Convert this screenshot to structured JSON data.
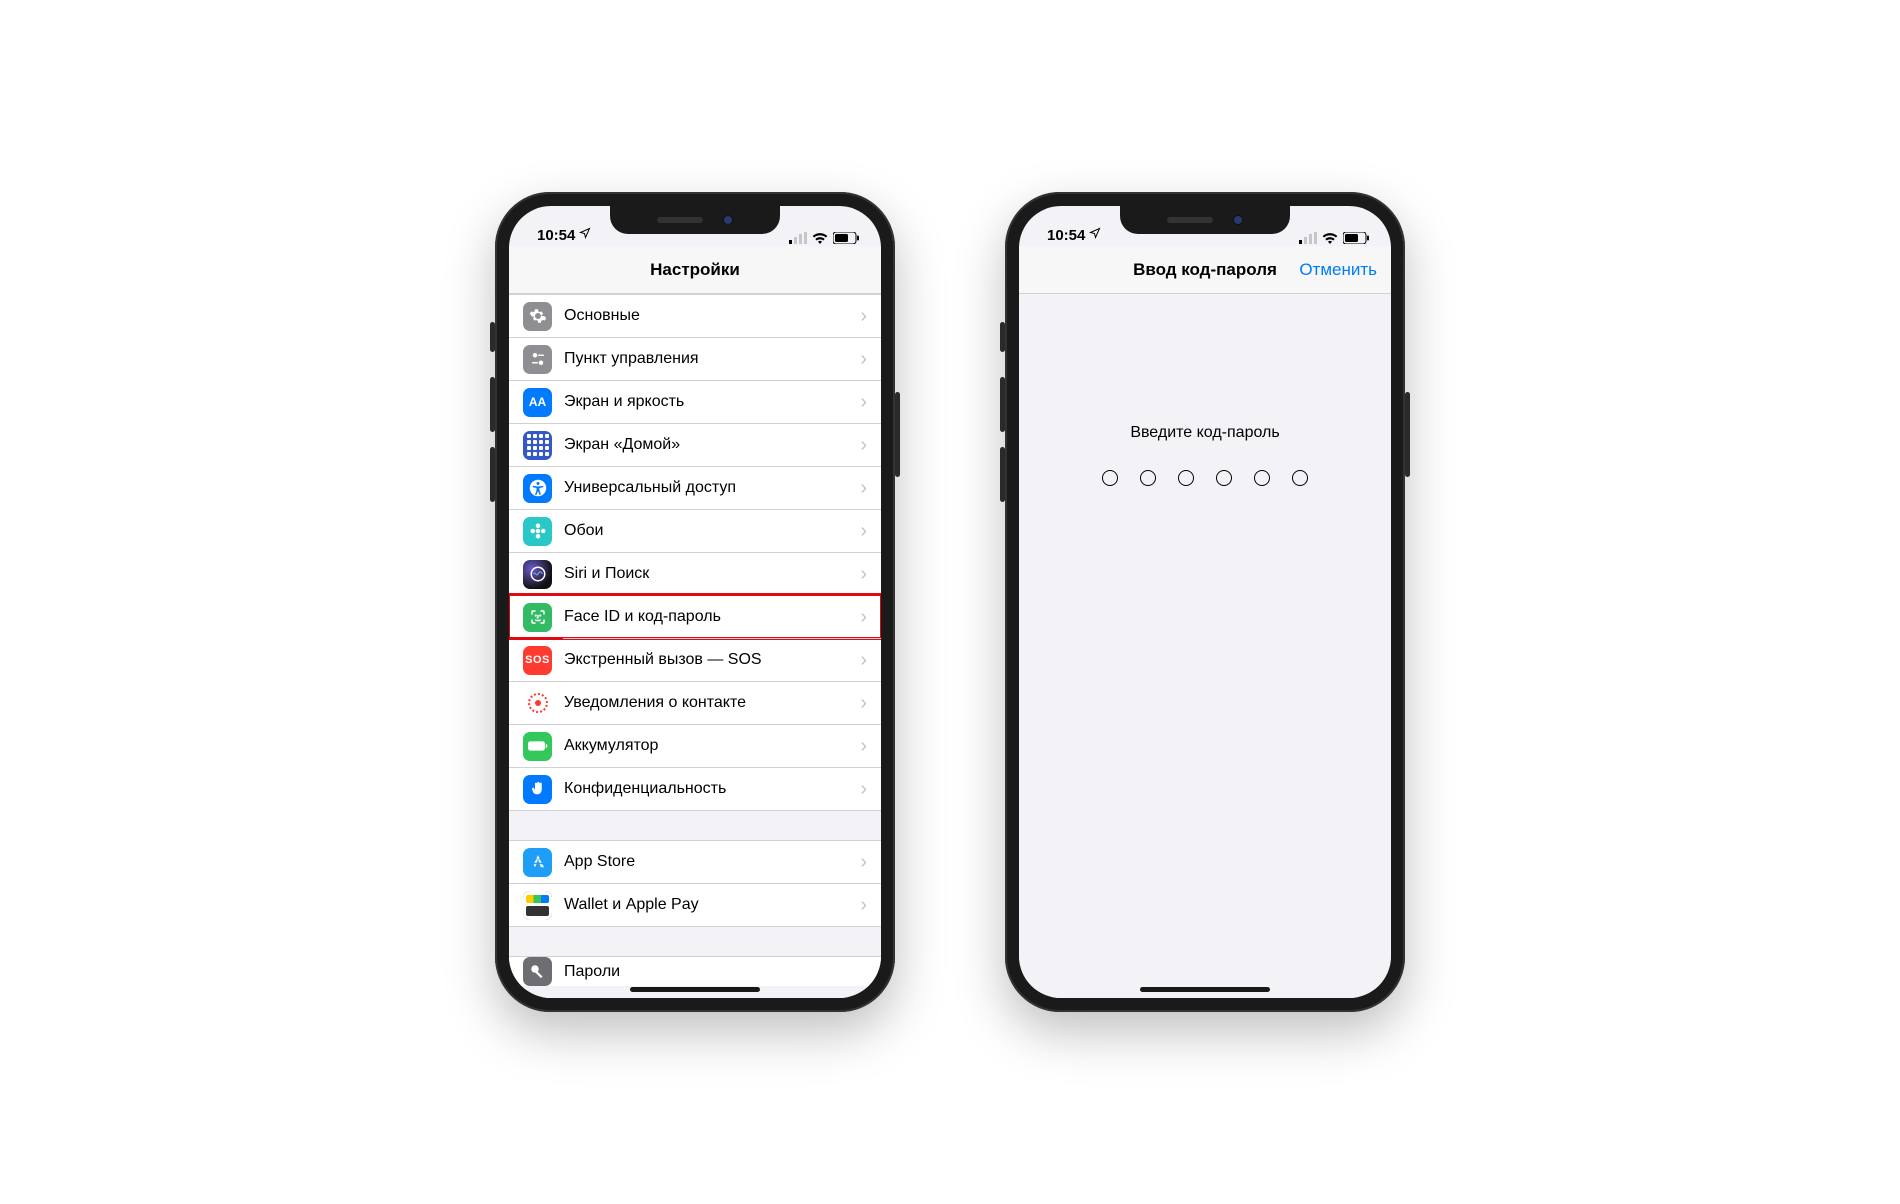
{
  "status": {
    "time": "10:54"
  },
  "phone1": {
    "nav_title": "Настройки",
    "groups": [
      {
        "items": [
          {
            "key": "general",
            "label": "Основные",
            "bg": "c-gray",
            "icon": "gear-icon"
          },
          {
            "key": "control-center",
            "label": "Пункт управления",
            "bg": "c-dgray",
            "icon": "sliders-icon"
          },
          {
            "key": "display",
            "label": "Экран и яркость",
            "bg": "c-blue",
            "icon": "text-size-icon",
            "glyph": "AA"
          },
          {
            "key": "home-screen",
            "label": "Экран «Домой»",
            "bg": "dots-grid",
            "icon": "grid-icon"
          },
          {
            "key": "accessibility",
            "label": "Универсальный доступ",
            "bg": "c-cyan",
            "icon": "accessibility-icon"
          },
          {
            "key": "wallpaper",
            "label": "Обои",
            "bg": "c-teal",
            "icon": "flower-icon"
          },
          {
            "key": "siri",
            "label": "Siri и Поиск",
            "bg": "c-black",
            "icon": "siri-icon"
          },
          {
            "key": "faceid",
            "label": "Face ID и код-пароль",
            "bg": "c-green",
            "icon": "faceid-icon",
            "highlight": true
          },
          {
            "key": "sos",
            "label": "Экстренный вызов — SOS",
            "bg": "sos",
            "icon": "sos-icon",
            "glyph": "SOS"
          },
          {
            "key": "exposure",
            "label": "Уведомления о контакте",
            "bg": "contact",
            "icon": "exposure-icon"
          },
          {
            "key": "battery",
            "label": "Аккумулятор",
            "bg": "battery-g",
            "icon": "battery-icon"
          },
          {
            "key": "privacy",
            "label": "Конфиденциальность",
            "bg": "privacy",
            "icon": "hand-icon"
          }
        ]
      },
      {
        "gap": true,
        "items": [
          {
            "key": "appstore",
            "label": "App Store",
            "bg": "appstore",
            "icon": "appstore-icon"
          },
          {
            "key": "wallet",
            "label": "Wallet и Apple Pay",
            "bg": "wallet",
            "icon": "wallet-icon"
          }
        ]
      },
      {
        "gap": true,
        "partial": true,
        "items": [
          {
            "key": "passwords",
            "label": "Пароли",
            "bg": "c-dgray2",
            "icon": "key-icon"
          }
        ]
      }
    ]
  },
  "phone2": {
    "nav_title": "Ввод код-пароля",
    "nav_cancel": "Отменить",
    "prompt": "Введите код-пароль",
    "passcode_length": 6
  }
}
